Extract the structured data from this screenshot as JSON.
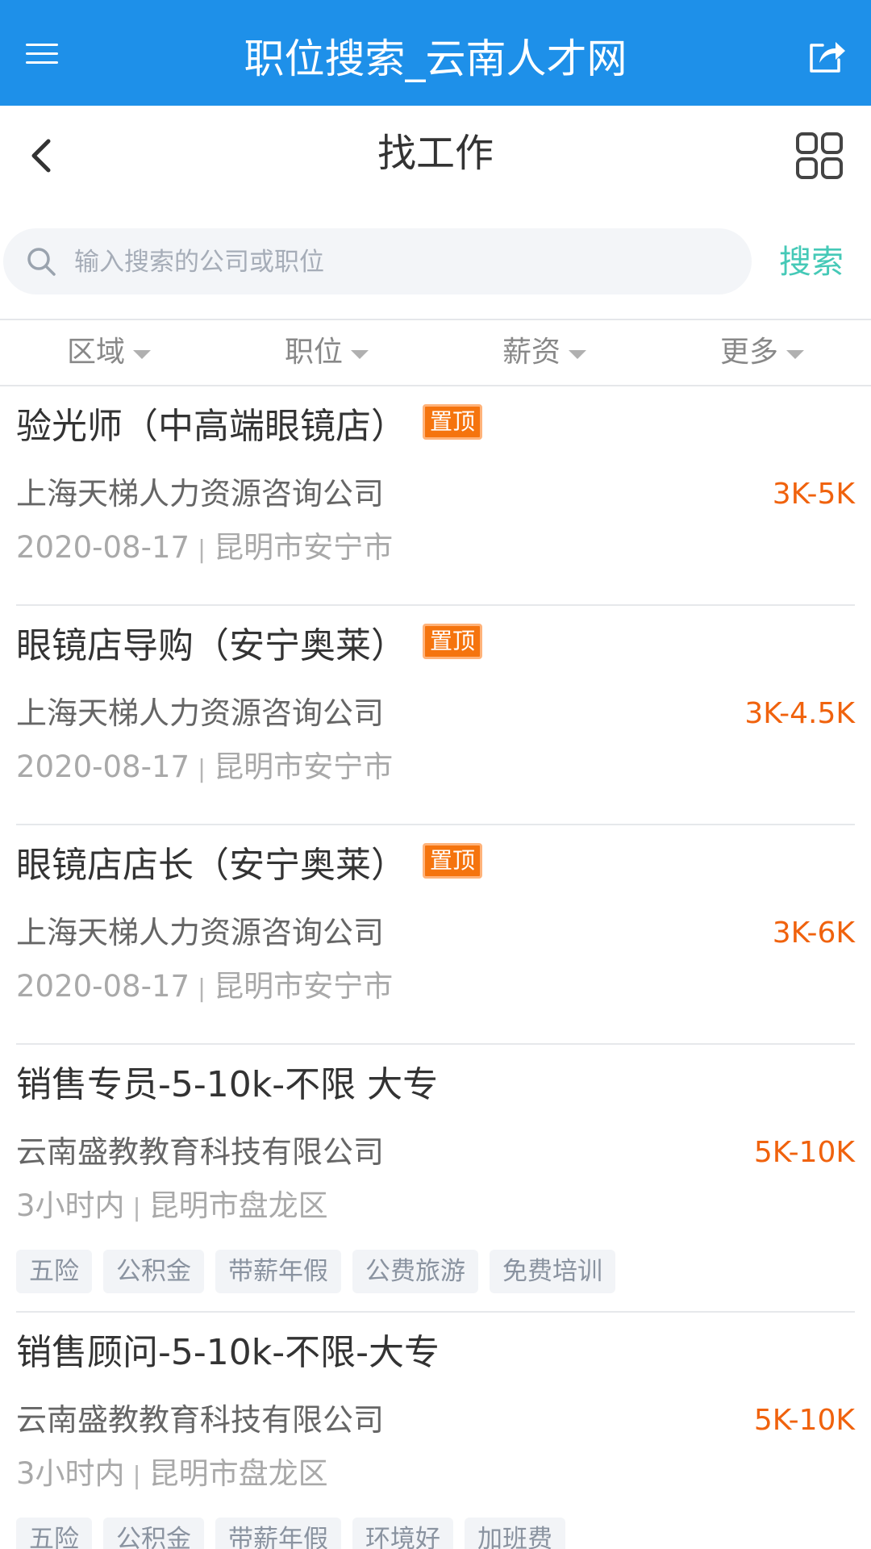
{
  "app_bar": {
    "title": "职位搜索_云南人才网"
  },
  "nav": {
    "title": "找工作"
  },
  "search": {
    "placeholder": "输入搜索的公司或职位",
    "button_label": "搜索"
  },
  "filters": [
    {
      "label": "区域"
    },
    {
      "label": "职位"
    },
    {
      "label": "薪资"
    },
    {
      "label": "更多"
    }
  ],
  "jobs": [
    {
      "title": "验光师（中高端眼镜店）",
      "badge": "置顶",
      "company": "上海天梯人力资源咨询公司",
      "salary": "3K-5K",
      "date": "2020-08-17",
      "separator": "|",
      "location": "昆明市安宁市",
      "tags": []
    },
    {
      "title": "眼镜店导购（安宁奥莱）",
      "badge": "置顶",
      "company": "上海天梯人力资源咨询公司",
      "salary": "3K-4.5K",
      "date": "2020-08-17",
      "separator": "|",
      "location": "昆明市安宁市",
      "tags": []
    },
    {
      "title": "眼镜店店长（安宁奥莱）",
      "badge": "置顶",
      "company": "上海天梯人力资源咨询公司",
      "salary": "3K-6K",
      "date": "2020-08-17",
      "separator": "|",
      "location": "昆明市安宁市",
      "tags": []
    },
    {
      "title": "销售专员-5-10k-不限 大专",
      "badge": "",
      "company": "云南盛教教育科技有限公司",
      "salary": "5K-10K",
      "date": "3小时内",
      "separator": "|",
      "location": "昆明市盘龙区",
      "tags": [
        "五险",
        "公积金",
        "带薪年假",
        "公费旅游",
        "免费培训"
      ]
    },
    {
      "title": "销售顾问-5-10k-不限-大专",
      "badge": "",
      "company": "云南盛教教育科技有限公司",
      "salary": "5K-10K",
      "date": "3小时内",
      "separator": "|",
      "location": "昆明市盘龙区",
      "tags": [
        "五险",
        "公积金",
        "带薪年假",
        "环境好",
        "加班费"
      ]
    }
  ],
  "icons": {
    "menu": "menu-icon",
    "share": "share-icon",
    "back": "chevron-left-icon",
    "grid": "grid-icon",
    "search": "search-icon",
    "caret": "caret-down-icon"
  },
  "colors": {
    "header_bg": "#1e90e9",
    "search_button": "#45c9b7",
    "salary": "#f0620d",
    "badge": "#f5740e"
  }
}
